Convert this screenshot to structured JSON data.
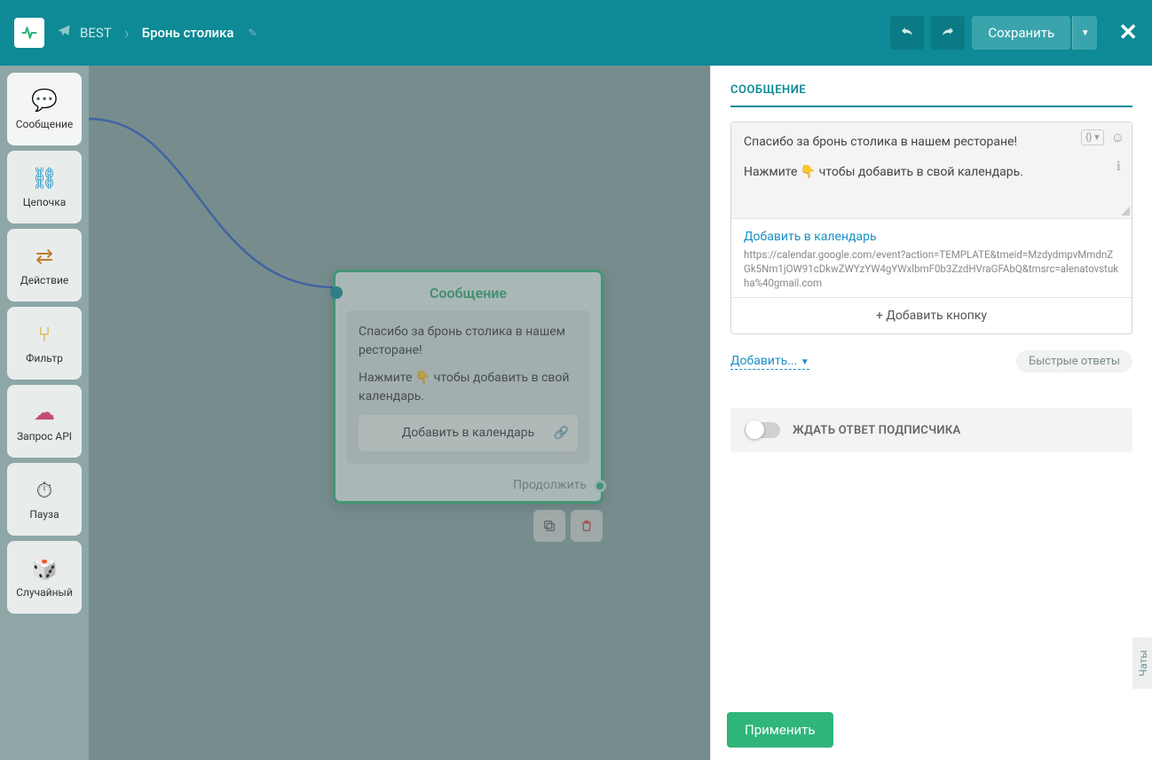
{
  "header": {
    "bot_name": "BEST",
    "flow_name": "Бронь столика",
    "save_label": "Сохранить"
  },
  "tools": [
    {
      "id": "message",
      "label": "Сообщение",
      "icon": "💬",
      "color": "#2fb37a"
    },
    {
      "id": "chain",
      "label": "Цепочка",
      "icon": "⛓",
      "color": "#1a8fc5"
    },
    {
      "id": "action",
      "label": "Действие",
      "icon": "⇄",
      "color": "#c07b2b"
    },
    {
      "id": "filter",
      "label": "Фильтр",
      "icon": "⑂",
      "color": "#e2a11f"
    },
    {
      "id": "api",
      "label": "Запрос API",
      "icon": "☁",
      "color": "#c44b77"
    },
    {
      "id": "pause",
      "label": "Пауза",
      "icon": "⏱",
      "color": "#555"
    },
    {
      "id": "random",
      "label": "Случайный",
      "icon": "🎲",
      "color": "#b54bb1"
    }
  ],
  "node": {
    "title": "Сообщение",
    "line1": "Спасибо за бронь столика в нашем ресторане!",
    "line2_pre": "Нажмите ",
    "line2_emoji": "👇",
    "line2_post": " чтобы добавить в свой календарь.",
    "button_label": "Добавить в календарь",
    "continue_label": "Продолжить"
  },
  "panel": {
    "title": "СООБЩЕНИЕ",
    "msg_line1": "Спасибо за бронь столика в нашем ресторане!",
    "msg_line2_pre": "Нажмите ",
    "msg_line2_emoji": "👇",
    "msg_line2_post": " чтобы добавить в свой календарь.",
    "button_title": "Добавить в календарь",
    "button_url": "https://calendar.google.com/event?action=TEMPLATE&tmeid=MzdydmpvMmdnZGk5Nm1jOW91cDkwZWYzYW4gYWxlbmF0b3ZzdHVraGFAbQ&tmsrc=alenatovstukha%40gmail.com",
    "add_button_label": "+ Добавить кнопку",
    "add_dropdown_label": "Добавить...",
    "quick_replies_label": "Быстрые ответы",
    "wait_toggle_label": "ЖДАТЬ ОТВЕТ ПОДПИСЧИКА",
    "apply_label": "Применить"
  },
  "chats_tab": "Чаты"
}
